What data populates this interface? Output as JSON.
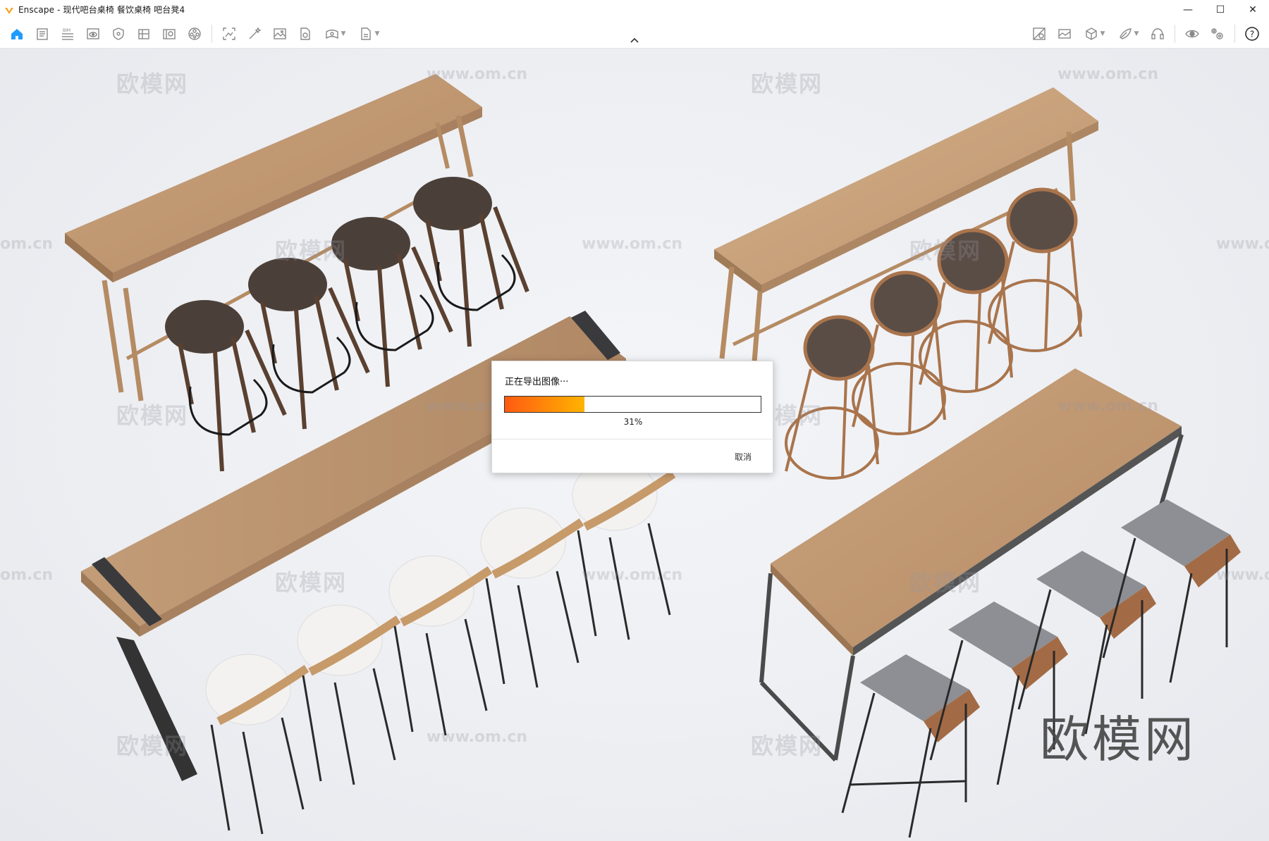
{
  "window": {
    "title": "Enscape - 现代吧台桌椅 餐饮桌椅 吧台凳4",
    "controls": {
      "minimize": "—",
      "maximize": "☐",
      "close": "✕"
    }
  },
  "toolbar": {
    "left_icons": [
      "home-icon",
      "notes-icon",
      "bim-icon",
      "view-icon",
      "shield-icon",
      "grid-icon",
      "asset-library-icon",
      "material-icon",
      "screenshot-icon",
      "magic-wand-icon",
      "image-export-icon",
      "file-export-icon",
      "panorama-icon",
      "export-document-icon"
    ],
    "right_icons": [
      "image-compare-icon",
      "gallery-icon",
      "cube-icon",
      "paint-icon",
      "headset-icon",
      "visibility-icon",
      "settings-icon",
      "help-icon"
    ],
    "help_label": "?"
  },
  "watermarks": {
    "brand_cn": "欧模网",
    "url": "www.om.cn",
    "url_fragment": "om.cn",
    "url_cut": "www.o"
  },
  "dialog": {
    "title": "正在导出图像···",
    "progress": 0.31,
    "progress_label": "31%",
    "cancel_label": "取消"
  },
  "colors": {
    "accent": "#1e9bff",
    "progress_start": "#ff5a12",
    "progress_end": "#ffb400",
    "logo": "#f5a623"
  }
}
